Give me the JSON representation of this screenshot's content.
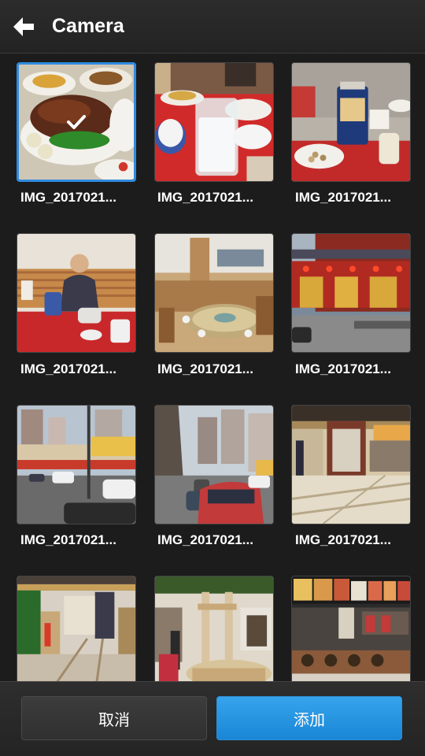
{
  "header": {
    "title": "Camera",
    "back_icon": "back-arrow-icon"
  },
  "grid": {
    "items": [
      {
        "caption": "IMG_2017021...",
        "selected": true
      },
      {
        "caption": "IMG_2017021...",
        "selected": false
      },
      {
        "caption": "IMG_2017021...",
        "selected": false
      },
      {
        "caption": "IMG_2017021...",
        "selected": false
      },
      {
        "caption": "IMG_2017021...",
        "selected": false
      },
      {
        "caption": "IMG_2017021...",
        "selected": false
      },
      {
        "caption": "IMG_2017021...",
        "selected": false
      },
      {
        "caption": "IMG_2017021...",
        "selected": false
      },
      {
        "caption": "IMG_2017021...",
        "selected": false
      },
      {
        "caption": "",
        "selected": false
      },
      {
        "caption": "",
        "selected": false
      },
      {
        "caption": "",
        "selected": false
      }
    ]
  },
  "footer": {
    "cancel_label": "取消",
    "add_label": "添加"
  },
  "colors": {
    "accent": "#2f8be0",
    "add_button": "#1a86d6",
    "background": "#1c1c1c"
  }
}
